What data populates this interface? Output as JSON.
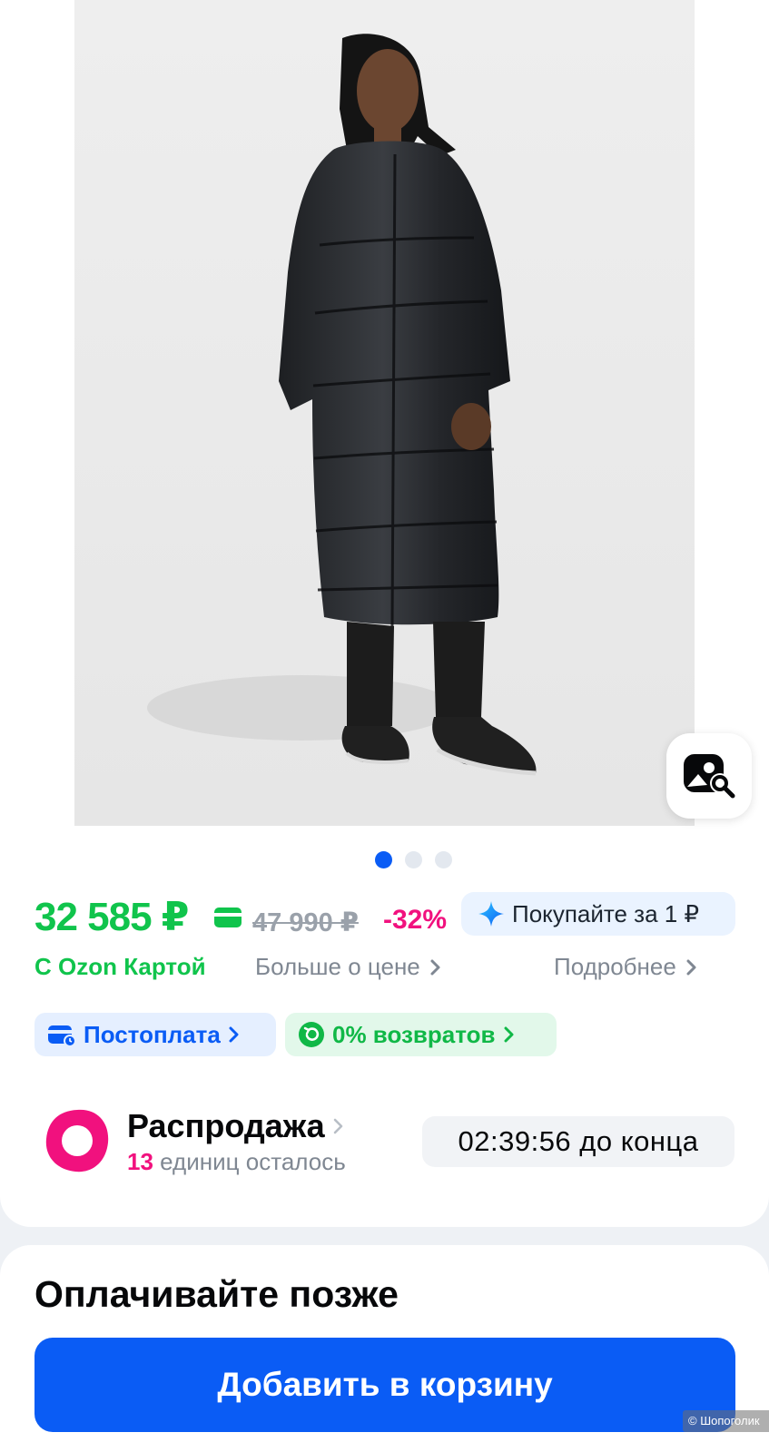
{
  "gallery": {
    "image_alt": "",
    "dot_count": 3,
    "active_dot": 0
  },
  "price": {
    "current": "32 585 ₽",
    "old": "47 990 ₽",
    "discount": "-32%",
    "ozon_card_label": "С Ozon Картой",
    "more_about_price": "Больше о цене",
    "promo_label": "Покупайте за 1 ₽",
    "details_label": "Подробнее"
  },
  "chips": {
    "postpay": "Постоплата",
    "returns": "0% возвратов"
  },
  "sale": {
    "title": "Распродажа",
    "count": "13",
    "units_text": "единиц осталось",
    "timer": "02:39:56 до конца"
  },
  "bottom": {
    "pay_later_title": "Оплачивайте позже",
    "add_to_cart": "Добавить в корзину"
  },
  "watermark": "© Шопоголик",
  "colors": {
    "brand_blue": "#0a5cf5",
    "price_green": "#10c44c",
    "discount_pink": "#f1117e",
    "muted_gray": "#7f8792"
  },
  "icons": {
    "visual_search": "image-search-icon",
    "card": "card-icon",
    "promo": "sparkle-icon",
    "chevron": "chevron-right-icon",
    "postpay": "wallet-icon",
    "returns": "return-icon",
    "sale": "sale-ring-icon"
  }
}
